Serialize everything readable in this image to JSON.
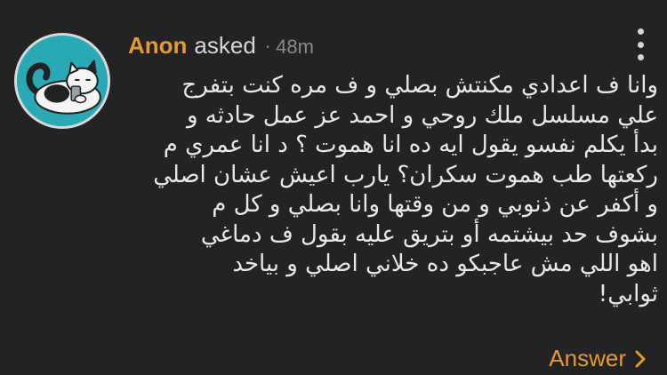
{
  "post": {
    "author": "Anon",
    "verb": "asked",
    "separator": "·",
    "time": "48m",
    "question_lines": [
      "وانا ف اعدادي مكنتش بصلي و ف مره كنت بتفرج",
      "علي مسلسل ملك روحي و احمد عز عمل حادثه و",
      "بدأ يكلم نفسو يقول ايه ده انا هموت ؟ د انا عمري م",
      "ركعتها طب هموت سكران؟ يارب اعيش عشان اصلي",
      "و أكفر عن ذنوبي و من وقتها وانا بصلي و كل م",
      "بشوف حد بيشتمه أو بتريق عليه بقول ف دماغي",
      "اهو اللي مش عاجبكو ده خلاني اصلي و بياخد",
      "ثوابي!"
    ],
    "answer_label": "Answer"
  },
  "icons": {
    "avatar": "cat-avatar-icon",
    "menu": "more-vertical-icon",
    "answer_arrow": "chevron-right-icon"
  },
  "colors": {
    "background": "#232326",
    "accent": "#e59a2f",
    "text": "#e8e8e8",
    "muted": "#8a8a8a",
    "avatar_bg": "#2aa8b5"
  }
}
